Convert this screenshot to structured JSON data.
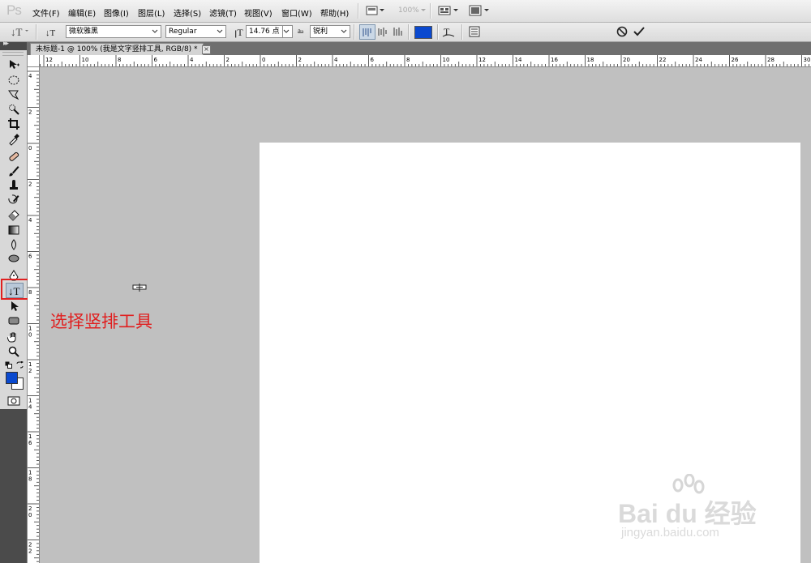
{
  "app": {
    "logo": "Ps",
    "menus": [
      "文件(F)",
      "编辑(E)",
      "图像(I)",
      "图层(L)",
      "选择(S)",
      "滤镜(T)",
      "视图(V)",
      "窗口(W)",
      "帮助(H)"
    ],
    "zoom_level": "100%"
  },
  "options_bar": {
    "font_family": "微软雅黑",
    "font_style": "Regular",
    "font_size": "14.76 点",
    "aa_label": "a",
    "antialias": "锐利",
    "text_color": "#0a49cf"
  },
  "document": {
    "tab_title": "未标题-1 @ 100% (我是文字竖排工具, RGB/8) *",
    "close_label": "×"
  },
  "rulers": {
    "horizontal": [
      "12",
      "10",
      "8",
      "6",
      "4",
      "2",
      "0",
      "2",
      "4",
      "6",
      "8",
      "10",
      "12",
      "14",
      "16",
      "18",
      "20",
      "22",
      "24",
      "26",
      "28",
      "30"
    ],
    "vertical": [
      "4",
      "2",
      "0",
      "2",
      "4",
      "6",
      "8",
      "1 0",
      "1 2",
      "1 4",
      "1 6",
      "1 8",
      "2 0",
      "2 2"
    ]
  },
  "annotation": "选择竖排工具",
  "watermark": {
    "main": "Bai du 经验",
    "sub": "jingyan.baidu.com"
  },
  "colors": {
    "foreground": "#0a49cf",
    "background": "#ffffff",
    "highlight": "#e02020"
  }
}
